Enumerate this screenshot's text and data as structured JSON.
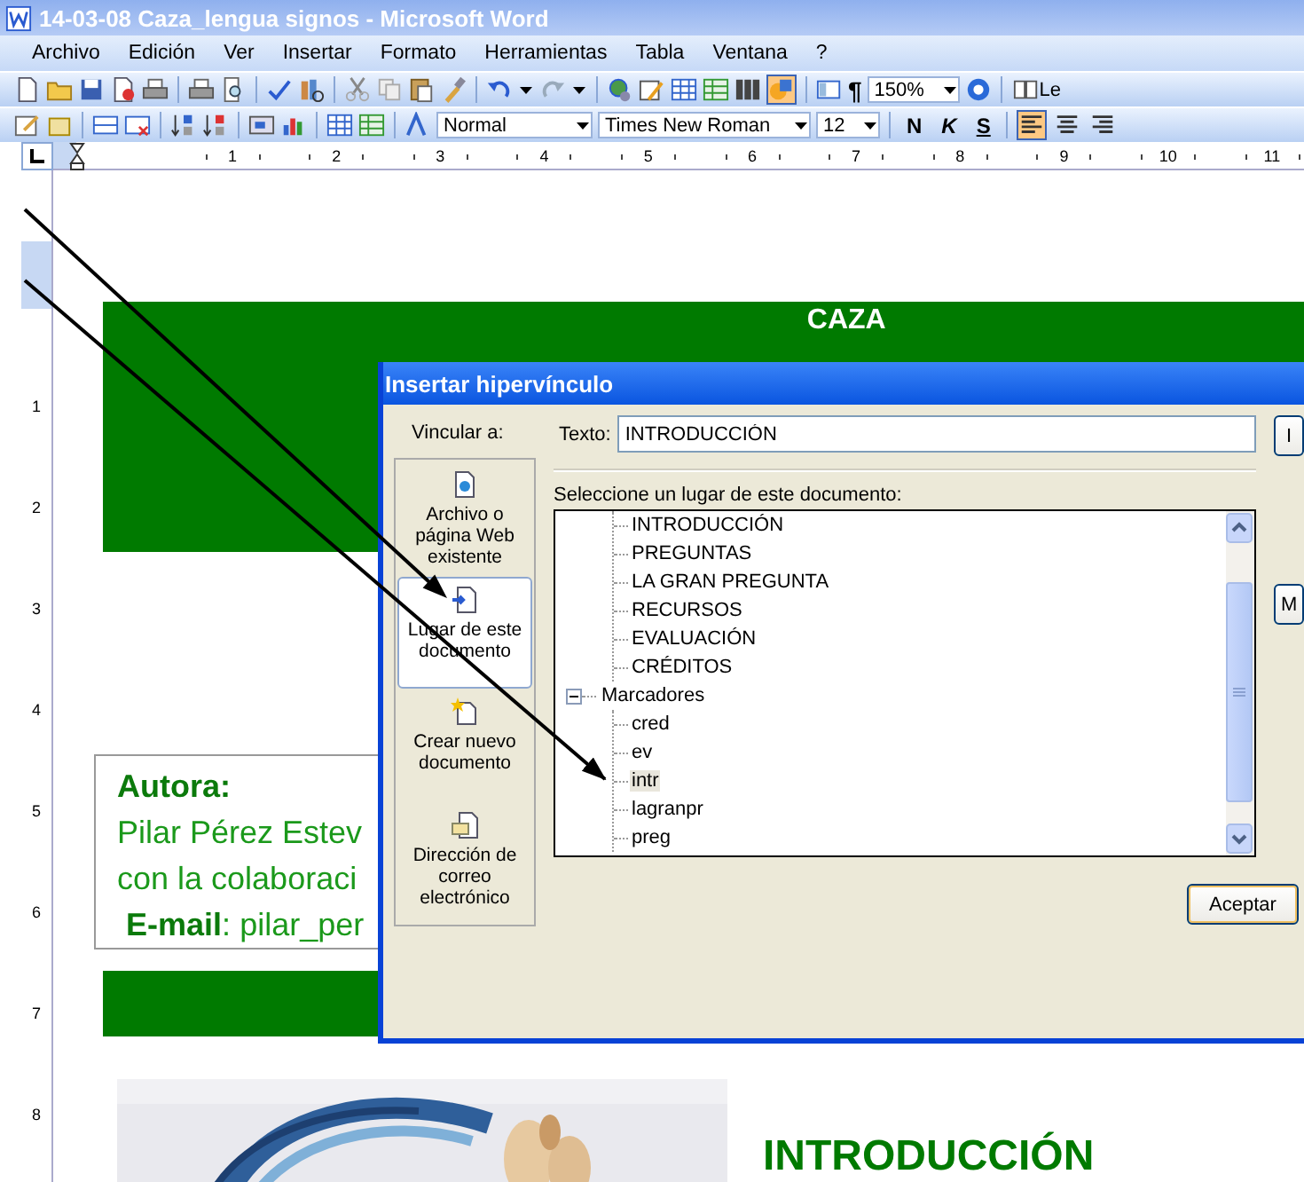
{
  "window": {
    "title": "14-03-08 Caza_lengua signos - Microsoft Word"
  },
  "menu": [
    "Archivo",
    "Edición",
    "Ver",
    "Insertar",
    "Formato",
    "Herramientas",
    "Tabla",
    "Ventana",
    "?"
  ],
  "standard_toolbar": {
    "zoom": "150%",
    "pilcrow": "¶",
    "reading_label": "Le",
    "drawing_on": true
  },
  "formatting_toolbar": {
    "style": "Normal",
    "font": "Times New Roman",
    "size": "12",
    "format_buttons": [
      {
        "label": "N",
        "selected": false
      },
      {
        "label": "K",
        "selected": false
      },
      {
        "label": "S",
        "selected": false
      }
    ],
    "align_buttons": [
      {
        "selected": true
      },
      {
        "selected": false
      },
      {
        "selected": false
      }
    ]
  },
  "ruler": {
    "numbers": [
      "1",
      "2",
      "3",
      "4",
      "5",
      "6",
      "7",
      "8",
      "9",
      "10",
      "11"
    ]
  },
  "vertical_ruler": {
    "numbers": [
      "1",
      "2",
      "3",
      "4",
      "5",
      "6",
      "7",
      "8"
    ]
  },
  "document": {
    "banner_title": "CAZA",
    "author_heading": "Autora:",
    "author_lines": [
      "Pilar Pérez Estev",
      "con la colaboraci"
    ],
    "email_label": "**E-mail**:",
    "email_link": "pilar_per",
    "section_heading": "INTRODUCCIÓN",
    "image": {
      "kind": "picture"
    }
  },
  "dialog": {
    "title": "Insertar hipervínculo",
    "link_to_label": "Vincular a:",
    "link_targets": [
      {
        "label": "Archivo o página Web existente",
        "selected": false
      },
      {
        "label": "Lugar de este documento",
        "selected": true
      },
      {
        "label": "Crear nuevo documento",
        "selected": false
      },
      {
        "label": "Dirección de correo electrónico",
        "selected": false
      }
    ],
    "text_label": "Texto:",
    "text_value": "INTRODUCCIÓN",
    "place_label": "Seleccione un lugar de este documento:",
    "tree": [
      {
        "children": [
          {
            "label": "INTRODUCCIÓN",
            "selected": false
          },
          {
            "label": "PREGUNTAS",
            "selected": false
          },
          {
            "label": "LA GRAN PREGUNTA",
            "selected": false
          },
          {
            "label": "RECURSOS",
            "selected": false
          },
          {
            "label": "EVALUACIÓN",
            "selected": false
          },
          {
            "label": "CRÉDITOS",
            "selected": false
          }
        ]
      },
      {
        "label": "Marcadores",
        "expanded": true,
        "children": [
          {
            "label": "cred",
            "selected": false
          },
          {
            "label": "ev",
            "selected": false
          },
          {
            "label": "intr",
            "selected": true
          },
          {
            "label": "lagranpr",
            "selected": false
          },
          {
            "label": "preg",
            "selected": false
          }
        ]
      }
    ],
    "side_buttons": [
      "I",
      "M"
    ],
    "ok_button": "Aceptar"
  }
}
